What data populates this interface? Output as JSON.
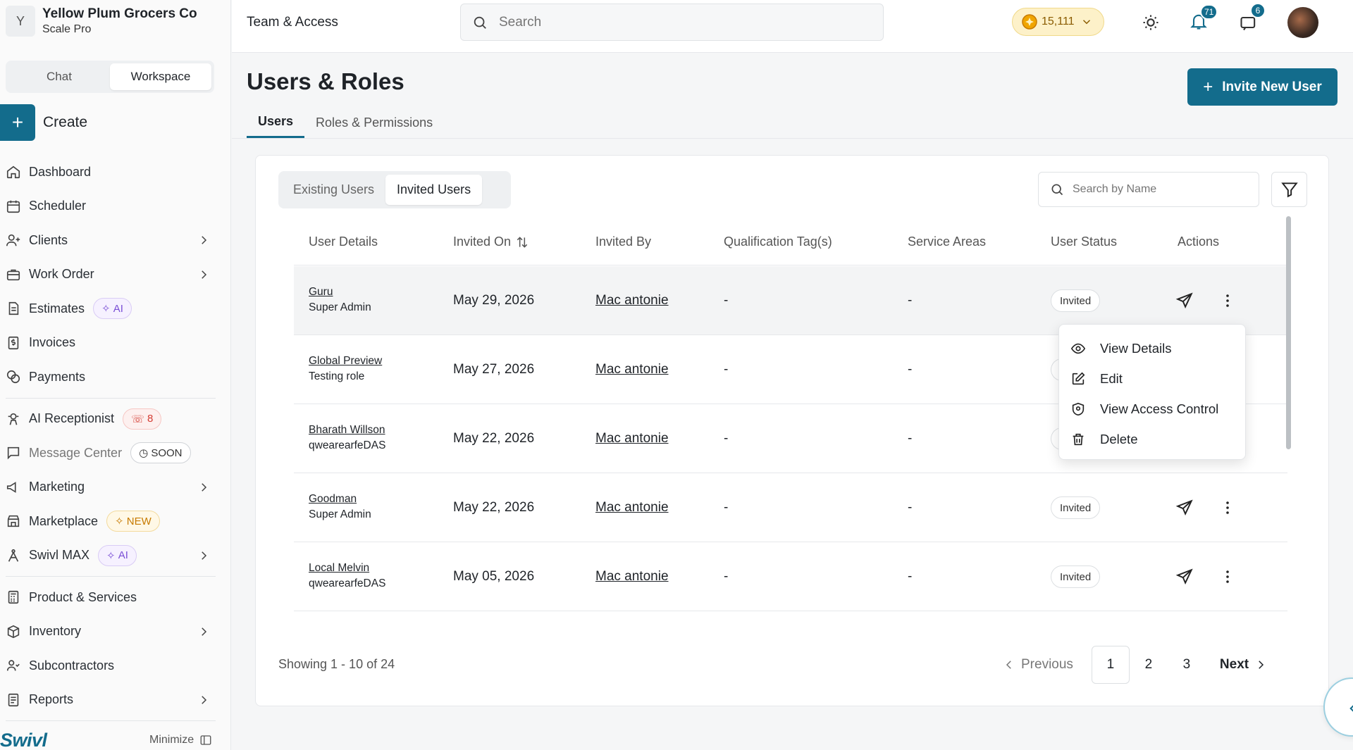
{
  "org": {
    "initial": "Y",
    "name": "Yellow Plum Grocers Co",
    "plan": "Scale Pro"
  },
  "mode_switch": {
    "chat": "Chat",
    "workspace": "Workspace",
    "active": "Workspace"
  },
  "create": {
    "icon": "plus-icon",
    "label": "Create"
  },
  "sidebar": {
    "items": [
      {
        "label": "Dashboard",
        "icon": "home-icon"
      },
      {
        "label": "Scheduler",
        "icon": "calendar-icon"
      },
      {
        "label": "Clients",
        "icon": "user-plus-icon",
        "has_submenu": true
      },
      {
        "label": "Work Order",
        "icon": "briefcase-icon",
        "has_submenu": true
      },
      {
        "label": "Estimates",
        "icon": "document-icon",
        "badge": "AI"
      },
      {
        "label": "Invoices",
        "icon": "invoice-dollar-icon"
      },
      {
        "label": "Payments",
        "icon": "coins-icon"
      },
      {
        "label": "AI Receptionist",
        "icon": "receptionist-icon",
        "badge": "8"
      },
      {
        "label": "Message Center",
        "icon": "message-icon",
        "badge": "SOON"
      },
      {
        "label": "Marketing",
        "icon": "megaphone-icon",
        "has_submenu": true
      },
      {
        "label": "Marketplace",
        "icon": "store-icon",
        "badge": "NEW"
      },
      {
        "label": "Swivl MAX",
        "icon": "max-icon",
        "badge": "AI",
        "has_submenu": true
      },
      {
        "label": "Product & Services",
        "icon": "calculator-icon"
      },
      {
        "label": "Inventory",
        "icon": "box-icon",
        "has_submenu": true
      },
      {
        "label": "Subcontractors",
        "icon": "users-icon"
      },
      {
        "label": "Reports",
        "icon": "report-icon",
        "has_submenu": true
      }
    ],
    "brand": "Swivl",
    "minimize_label": "Minimize"
  },
  "topbar": {
    "title": "Team & Access",
    "search_placeholder": "Search",
    "coins": "15,111",
    "notifications_count": "71",
    "messages_count": "6"
  },
  "page": {
    "title": "Users & Roles",
    "invite_button": "Invite New User",
    "tabs": [
      "Users",
      "Roles & Permissions"
    ],
    "active_tab": "Users"
  },
  "users_panel": {
    "subtabs": [
      "Existing Users",
      "Invited Users"
    ],
    "active_subtab": "Invited Users",
    "search_placeholder": "Search by Name",
    "columns": [
      "User Details",
      "Invited On",
      "Invited By",
      "Qualification Tag(s)",
      "Service Areas",
      "User Status",
      "Actions"
    ],
    "rows": [
      {
        "name": "Guru",
        "role": "Super Admin",
        "invited_on": "May 29, 2026",
        "invited_by": "Mac antonie",
        "tags": "-",
        "areas": "-",
        "status": "Invited"
      },
      {
        "name": "Global Preview",
        "role": "Testing role",
        "invited_on": "May 27, 2026",
        "invited_by": "Mac antonie",
        "tags": "-",
        "areas": "-",
        "status": ""
      },
      {
        "name": "Bharath Willson",
        "role": "qwearearfeDAS",
        "invited_on": "May 22, 2026",
        "invited_by": "Mac antonie",
        "tags": "-",
        "areas": "-",
        "status": ""
      },
      {
        "name": "Goodman",
        "role": "Super Admin",
        "invited_on": "May 22, 2026",
        "invited_by": "Mac antonie",
        "tags": "-",
        "areas": "-",
        "status": "Invited"
      },
      {
        "name": "Local Melvin",
        "role": "qwearearfeDAS",
        "invited_on": "May 05, 2026",
        "invited_by": "Mac antonie",
        "tags": "-",
        "areas": "-",
        "status": "Invited"
      }
    ],
    "action_menu": [
      "View Details",
      "Edit",
      "View Access Control",
      "Delete"
    ],
    "showing": "Showing 1 - 10 of 24",
    "pagination": {
      "previous": "Previous",
      "pages": [
        "1",
        "2",
        "3"
      ],
      "current": "1",
      "next": "Next"
    }
  },
  "colors": {
    "accent": "#136c8c",
    "ai_badge": "#7a4fd6",
    "call_badge": "#d43c33",
    "new_badge": "#c77a00",
    "coins": "#fdf1c9"
  }
}
